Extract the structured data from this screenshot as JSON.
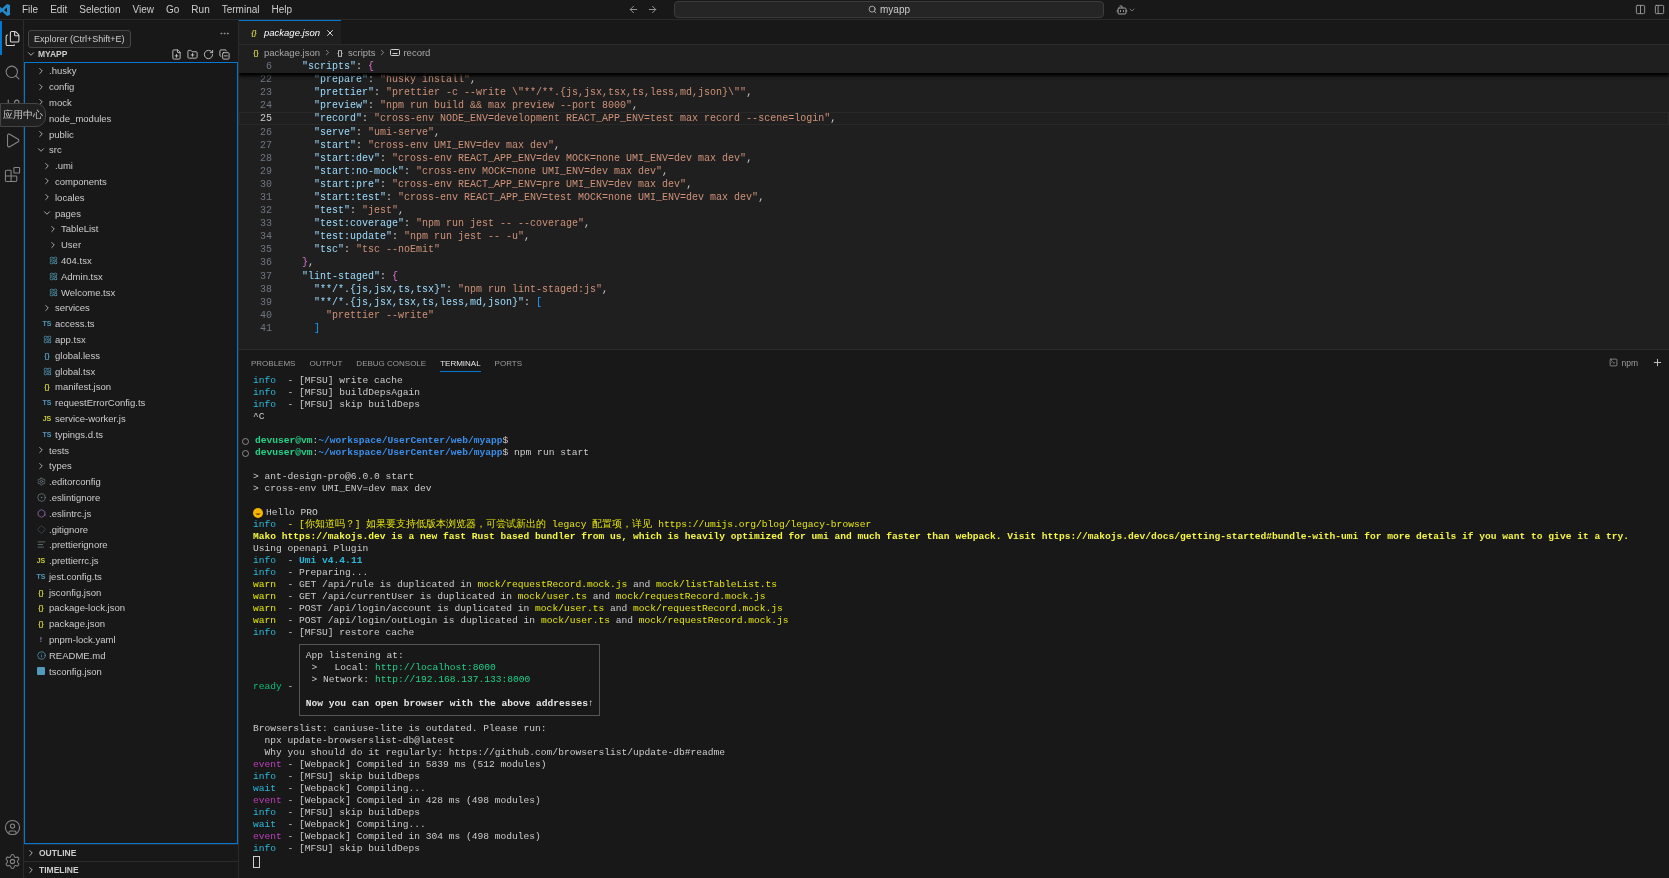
{
  "title_bar": {
    "menu": [
      "File",
      "Edit",
      "Selection",
      "View",
      "Go",
      "Run",
      "Terminal",
      "Help"
    ],
    "search": "myapp"
  },
  "activity_bar": {
    "top": [
      {
        "kind": "explorer",
        "selected": true
      },
      {
        "kind": "search",
        "selected": false
      },
      {
        "kind": "source-control",
        "selected": false
      },
      {
        "kind": "run",
        "selected": false
      },
      {
        "kind": "extensions",
        "selected": false
      }
    ],
    "bottom": [
      {
        "kind": "account"
      },
      {
        "kind": "settings"
      }
    ]
  },
  "tooltips": {
    "explorer": "Explorer (Ctrl+Shift+E)",
    "app_center": "应用中心"
  },
  "sidebar": {
    "root": "MYAPP",
    "tree": [
      {
        "name": ".husky",
        "kind": "folder",
        "expanded": false
      },
      {
        "name": "config",
        "kind": "folder",
        "expanded": false
      },
      {
        "name": "mock",
        "kind": "folder",
        "expanded": false
      },
      {
        "name": "node_modules",
        "kind": "folder"
      },
      {
        "name": "public",
        "kind": "folder",
        "expanded": false
      },
      {
        "name": "src",
        "kind": "folder",
        "expanded": true,
        "children": [
          {
            "name": ".umi",
            "kind": "folder",
            "expanded": false
          },
          {
            "name": "components",
            "kind": "folder",
            "expanded": false
          },
          {
            "name": "locales",
            "kind": "folder",
            "expanded": false
          },
          {
            "name": "pages",
            "kind": "folder",
            "expanded": true,
            "children": [
              {
                "name": "TableList",
                "kind": "folder",
                "expanded": false
              },
              {
                "name": "User",
                "kind": "folder",
                "expanded": false
              },
              {
                "name": "404.tsx",
                "kind": "react"
              },
              {
                "name": "Admin.tsx",
                "kind": "react"
              },
              {
                "name": "Welcome.tsx",
                "kind": "react"
              }
            ]
          },
          {
            "name": "services",
            "kind": "folder",
            "expanded": false
          },
          {
            "name": "access.ts",
            "kind": "ts",
            "badge": "TS"
          },
          {
            "name": "app.tsx",
            "kind": "react"
          },
          {
            "name": "global.less",
            "kind": "less",
            "badge": "{}"
          },
          {
            "name": "global.tsx",
            "kind": "react"
          },
          {
            "name": "manifest.json",
            "kind": "json",
            "badge": "{}"
          },
          {
            "name": "requestErrorConfig.ts",
            "kind": "ts",
            "badge": "TS"
          },
          {
            "name": "service-worker.js",
            "kind": "js",
            "badge": "JS"
          },
          {
            "name": "typings.d.ts",
            "kind": "ts",
            "badge": "TS"
          }
        ]
      },
      {
        "name": "tests",
        "kind": "folder",
        "expanded": false
      },
      {
        "name": "types",
        "kind": "folder",
        "expanded": false
      },
      {
        "name": ".editorconfig",
        "kind": "gear"
      },
      {
        "name": ".eslintignore",
        "kind": "ignore"
      },
      {
        "name": ".eslintrc.js",
        "kind": "eslint"
      },
      {
        "name": ".gitignore",
        "kind": "git"
      },
      {
        "name": ".prettierignore",
        "kind": "lines"
      },
      {
        "name": ".prettierrc.js",
        "kind": "js",
        "badge": "JS"
      },
      {
        "name": "jest.config.ts",
        "kind": "ts",
        "badge": "TS"
      },
      {
        "name": "jsconfig.json",
        "kind": "json",
        "badge": "{}"
      },
      {
        "name": "package-lock.json",
        "kind": "json",
        "badge": "{}"
      },
      {
        "name": "package.json",
        "kind": "json",
        "badge": "{}"
      },
      {
        "name": "pnpm-lock.yaml",
        "kind": "yaml",
        "badge": "!"
      },
      {
        "name": "README.md",
        "kind": "info"
      },
      {
        "name": "tsconfig.json",
        "kind": "tsconfig"
      }
    ],
    "sections": [
      {
        "label": "OUTLINE",
        "expanded": false
      },
      {
        "label": "TIMELINE",
        "expanded": false
      }
    ]
  },
  "editor": {
    "tabs": [
      {
        "label": "package.json",
        "badge": "{}",
        "selected": true,
        "preview": true
      }
    ],
    "breadcrumbs": [
      {
        "label": "package.json",
        "kind": "file",
        "badge": "{}"
      },
      {
        "label": "scripts",
        "kind": "object",
        "badge": "{}"
      },
      {
        "label": "record",
        "kind": "string"
      }
    ],
    "sticky_line": {
      "number": "6",
      "code": "  \"scripts\": {"
    },
    "lines": [
      {
        "number": "22",
        "code": "    \"prepare\": \"husky install\",",
        "current": false
      },
      {
        "number": "23",
        "code": "    \"prettier\": \"prettier -c --write \\\"**/**.{js,jsx,tsx,ts,less,md,json}\\\"\",",
        "current": false
      },
      {
        "number": "24",
        "code": "    \"preview\": \"npm run build && max preview --port 8000\",",
        "current": false
      },
      {
        "number": "25",
        "code": "    \"record\": \"cross-env NODE_ENV=development REACT_APP_ENV=test max record --scene=login\",",
        "current": true
      },
      {
        "number": "26",
        "code": "    \"serve\": \"umi-serve\",",
        "current": false
      },
      {
        "number": "27",
        "code": "    \"start\": \"cross-env UMI_ENV=dev max dev\",",
        "current": false
      },
      {
        "number": "28",
        "code": "    \"start:dev\": \"cross-env REACT_APP_ENV=dev MOCK=none UMI_ENV=dev max dev\",",
        "current": false
      },
      {
        "number": "29",
        "code": "    \"start:no-mock\": \"cross-env MOCK=none UMI_ENV=dev max dev\",",
        "current": false
      },
      {
        "number": "30",
        "code": "    \"start:pre\": \"cross-env REACT_APP_ENV=pre UMI_ENV=dev max dev\",",
        "current": false
      },
      {
        "number": "31",
        "code": "    \"start:test\": \"cross-env REACT_APP_ENV=test MOCK=none UMI_ENV=dev max dev\",",
        "current": false
      },
      {
        "number": "32",
        "code": "    \"test\": \"jest\",",
        "current": false
      },
      {
        "number": "33",
        "code": "    \"test:coverage\": \"npm run jest -- --coverage\",",
        "current": false
      },
      {
        "number": "34",
        "code": "    \"test:update\": \"npm run jest -- -u\",",
        "current": false
      },
      {
        "number": "35",
        "code": "    \"tsc\": \"tsc --noEmit\"",
        "current": false
      },
      {
        "number": "36",
        "code": "  },",
        "current": false
      },
      {
        "number": "37",
        "code": "  \"lint-staged\": {",
        "current": false
      },
      {
        "number": "38",
        "code": "    \"**/*.{js,jsx,ts,tsx}\": \"npm run lint-staged:js\",",
        "current": false
      },
      {
        "number": "39",
        "code": "    \"**/*.{js,jsx,tsx,ts,less,md,json}\": [",
        "current": false
      },
      {
        "number": "40",
        "code": "      \"prettier --write\"",
        "current": false
      },
      {
        "number": "41",
        "code": "    ]",
        "current": false
      }
    ]
  },
  "panel": {
    "tabs": [
      {
        "label": "PROBLEMS",
        "selected": false
      },
      {
        "label": "OUTPUT",
        "selected": false
      },
      {
        "label": "DEBUG CONSOLE",
        "selected": false
      },
      {
        "label": "TERMINAL",
        "selected": true
      },
      {
        "label": "PORTS",
        "selected": false
      }
    ],
    "terminal_name": "npm",
    "terminal": [
      {
        "kind": "text",
        "parts": [
          {
            "text": "info",
            "kind": "info"
          },
          {
            "text": "  - [MFSU] write cache"
          }
        ]
      },
      {
        "kind": "text",
        "parts": [
          {
            "text": "info",
            "kind": "info"
          },
          {
            "text": "  - [MFSU] buildDepsAgain"
          }
        ]
      },
      {
        "kind": "text",
        "parts": [
          {
            "text": "info",
            "kind": "info"
          },
          {
            "text": "  - [MFSU] skip buildDeps"
          }
        ]
      },
      {
        "kind": "text",
        "parts": [
          {
            "text": "^C"
          }
        ]
      },
      {
        "kind": "blank"
      },
      {
        "kind": "command",
        "parts": [
          {
            "text": "devuser@vm",
            "kind": "user"
          },
          {
            "text": ":"
          },
          {
            "text": "~/workspace/UserCenter/web/myapp",
            "kind": "path"
          },
          {
            "text": "$"
          }
        ]
      },
      {
        "kind": "command",
        "parts": [
          {
            "text": "devuser@vm",
            "kind": "user"
          },
          {
            "text": ":"
          },
          {
            "text": "~/workspace/UserCenter/web/myapp",
            "kind": "path"
          },
          {
            "text": "$ npm run start"
          }
        ]
      },
      {
        "kind": "blank"
      },
      {
        "kind": "text",
        "parts": [
          {
            "text": "> ant-design-pro@6.0.0 start"
          }
        ]
      },
      {
        "kind": "text",
        "parts": [
          {
            "text": "> cross-env UMI_ENV=dev max dev"
          }
        ]
      },
      {
        "kind": "blank"
      },
      {
        "kind": "greeting",
        "parts": [
          {
            "text": "Hello PRO"
          }
        ]
      },
      {
        "kind": "text",
        "parts": [
          {
            "text": "info",
            "kind": "info"
          },
          {
            "text": "  - [你知道吗？] 如果要支持低版本浏览器，可尝试新出的 legacy 配置项，详见 https://umijs.org/blog/legacy-browser",
            "kind": "notice"
          }
        ]
      },
      {
        "kind": "text",
        "parts": [
          {
            "text": "Mako https://makojs.dev is a new fast Rust based bundler from us, which is heavily optimized for umi and much faster than webpack. Visit https://makojs.dev/docs/getting-started#bundle-with-umi for more details if you want to give it a try.",
            "kind": "banner"
          }
        ]
      },
      {
        "kind": "text",
        "parts": [
          {
            "text": "Using openapi Plugin"
          }
        ]
      },
      {
        "kind": "text",
        "parts": [
          {
            "text": "info",
            "kind": "info"
          },
          {
            "text": "  - "
          },
          {
            "text": "Umi v4.4.11",
            "kind": "version"
          }
        ]
      },
      {
        "kind": "text",
        "parts": [
          {
            "text": "info",
            "kind": "info"
          },
          {
            "text": "  - Preparing..."
          }
        ]
      },
      {
        "kind": "text",
        "parts": [
          {
            "text": "warn",
            "kind": "warn"
          },
          {
            "text": "  - GET /api/rule is duplicated in "
          },
          {
            "text": "mock/requestRecord.mock.js",
            "kind": "file"
          },
          {
            "text": " and "
          },
          {
            "text": "mock/listTableList.ts",
            "kind": "file"
          }
        ]
      },
      {
        "kind": "text",
        "parts": [
          {
            "text": "warn",
            "kind": "warn"
          },
          {
            "text": "  - GET /api/currentUser is duplicated in "
          },
          {
            "text": "mock/user.ts",
            "kind": "file"
          },
          {
            "text": " and "
          },
          {
            "text": "mock/requestRecord.mock.js",
            "kind": "file"
          }
        ]
      },
      {
        "kind": "text",
        "parts": [
          {
            "text": "warn",
            "kind": "warn"
          },
          {
            "text": "  - POST /api/login/account is duplicated in "
          },
          {
            "text": "mock/user.ts",
            "kind": "file"
          },
          {
            "text": " and "
          },
          {
            "text": "mock/requestRecord.mock.js",
            "kind": "file"
          }
        ]
      },
      {
        "kind": "text",
        "parts": [
          {
            "text": "warn",
            "kind": "warn"
          },
          {
            "text": "  - POST /api/login/outLogin is duplicated in "
          },
          {
            "text": "mock/user.ts",
            "kind": "file"
          },
          {
            "text": " and "
          },
          {
            "text": "mock/requestRecord.mock.js",
            "kind": "file"
          }
        ]
      },
      {
        "kind": "text",
        "parts": [
          {
            "text": "info",
            "kind": "info"
          },
          {
            "text": "  - [MFSU] restore cache"
          }
        ]
      },
      {
        "kind": "box",
        "label": [
          {
            "text": "ready",
            "kind": "ready"
          },
          {
            "text": " -"
          }
        ],
        "lines": [
          {
            "kind": "text",
            "parts": [
              {
                "text": "App listening at:"
              }
            ]
          },
          {
            "kind": "text",
            "parts": [
              {
                "text": " >   Local: "
              },
              {
                "text": "http://localhost:8000",
                "kind": "url"
              }
            ]
          },
          {
            "kind": "text",
            "parts": [
              {
                "text": " > Network: "
              },
              {
                "text": "http://192.168.137.133:8000",
                "kind": "url"
              }
            ]
          },
          {
            "kind": "blank"
          },
          {
            "kind": "text",
            "parts": [
              {
                "text": "Now you can open browser with the above addresses↑",
                "kind": "strong"
              }
            ]
          }
        ]
      },
      {
        "kind": "text",
        "parts": [
          {
            "text": "Browserslist: caniuse-lite is outdated. Please run:"
          }
        ]
      },
      {
        "kind": "text",
        "parts": [
          {
            "text": "  npx update-browserslist-db@latest"
          }
        ]
      },
      {
        "kind": "text",
        "parts": [
          {
            "text": "  Why you should do it regularly: https://github.com/browserslist/update-db#readme"
          }
        ]
      },
      {
        "kind": "text",
        "parts": [
          {
            "text": "event",
            "kind": "event"
          },
          {
            "text": " - [Webpack] Compiled in 5839 ms (512 modules)"
          }
        ]
      },
      {
        "kind": "text",
        "parts": [
          {
            "text": "info",
            "kind": "info"
          },
          {
            "text": "  - [MFSU] skip buildDeps"
          }
        ]
      },
      {
        "kind": "text",
        "parts": [
          {
            "text": "wait",
            "kind": "wait"
          },
          {
            "text": "  - [Webpack] Compiling..."
          }
        ]
      },
      {
        "kind": "text",
        "parts": [
          {
            "text": "event",
            "kind": "event"
          },
          {
            "text": " - [Webpack] Compiled in 428 ms (498 modules)"
          }
        ]
      },
      {
        "kind": "text",
        "parts": [
          {
            "text": "info",
            "kind": "info"
          },
          {
            "text": "  - [MFSU] skip buildDeps"
          }
        ]
      },
      {
        "kind": "text",
        "parts": [
          {
            "text": "wait",
            "kind": "wait"
          },
          {
            "text": "  - [Webpack] Compiling..."
          }
        ]
      },
      {
        "kind": "text",
        "parts": [
          {
            "text": "event",
            "kind": "event"
          },
          {
            "text": " - [Webpack] Compiled in 304 ms (498 modules)"
          }
        ]
      },
      {
        "kind": "text",
        "parts": [
          {
            "text": "info",
            "kind": "info"
          },
          {
            "text": "  - [MFSU] skip buildDeps"
          }
        ]
      },
      {
        "kind": "cursor"
      }
    ]
  }
}
